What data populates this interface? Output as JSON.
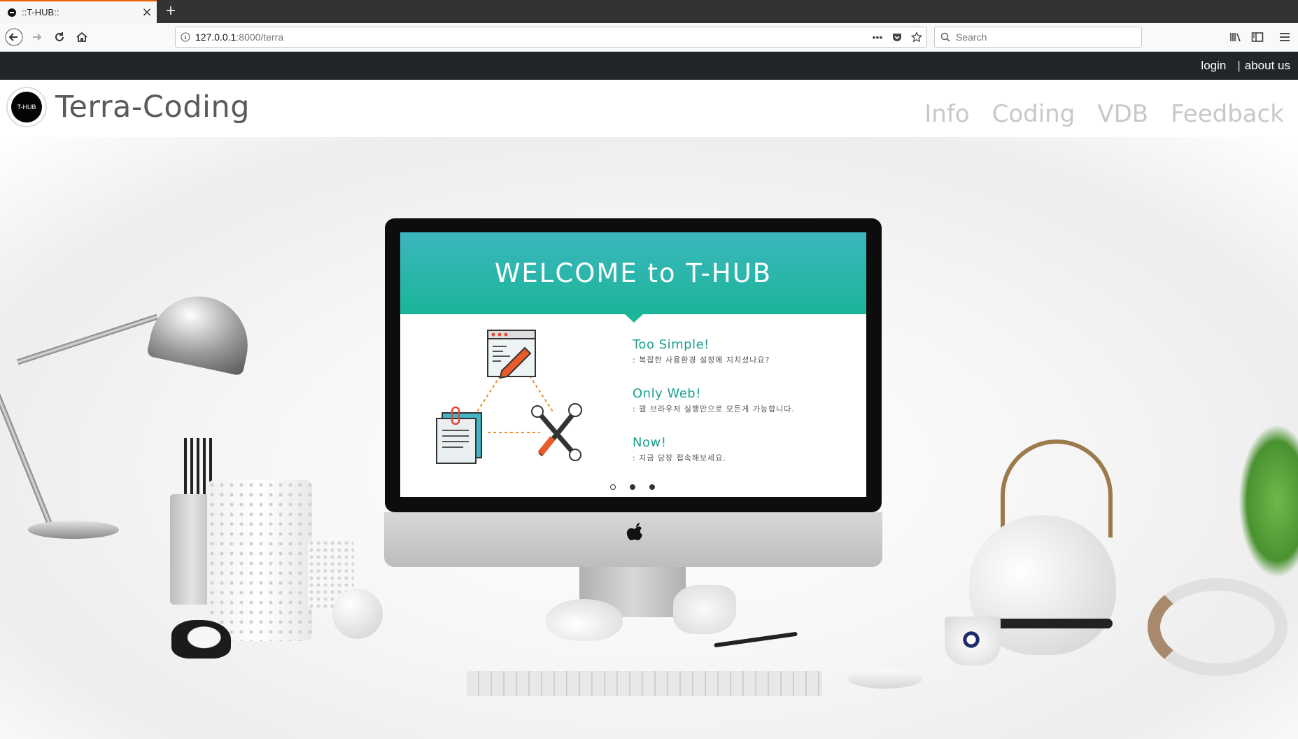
{
  "browser": {
    "tab_title": "::T-HUB::",
    "tab_close": "×",
    "new_tab": "+",
    "url_host": "127.0.0.1",
    "url_path": ":8000/terra",
    "search_placeholder": "Search"
  },
  "site": {
    "top_links": {
      "login": "login",
      "separator": "|",
      "about": "about us"
    },
    "logo_text": "T-HUB",
    "brand": "Terra-Coding",
    "nav": [
      "Info",
      "Coding",
      "VDB",
      "Feedback"
    ]
  },
  "hero": {
    "banner": "WELCOME to T-HUB",
    "features": [
      {
        "title": "Too Simple!",
        "desc": ": 복잡한 사용환경 설정에 지치셨나요?"
      },
      {
        "title": "Only Web!",
        "desc": ": 웹 브라우저 실행만으로 모든게 가능합니다."
      },
      {
        "title": "Now!",
        "desc": ": 지금 당장 접속해보세요."
      }
    ],
    "slide_count": 3,
    "active_slide": 1,
    "colors": {
      "banner_top": "#3cb6bf",
      "banner_bottom": "#1bb598",
      "accent": "#1aa08f"
    }
  }
}
